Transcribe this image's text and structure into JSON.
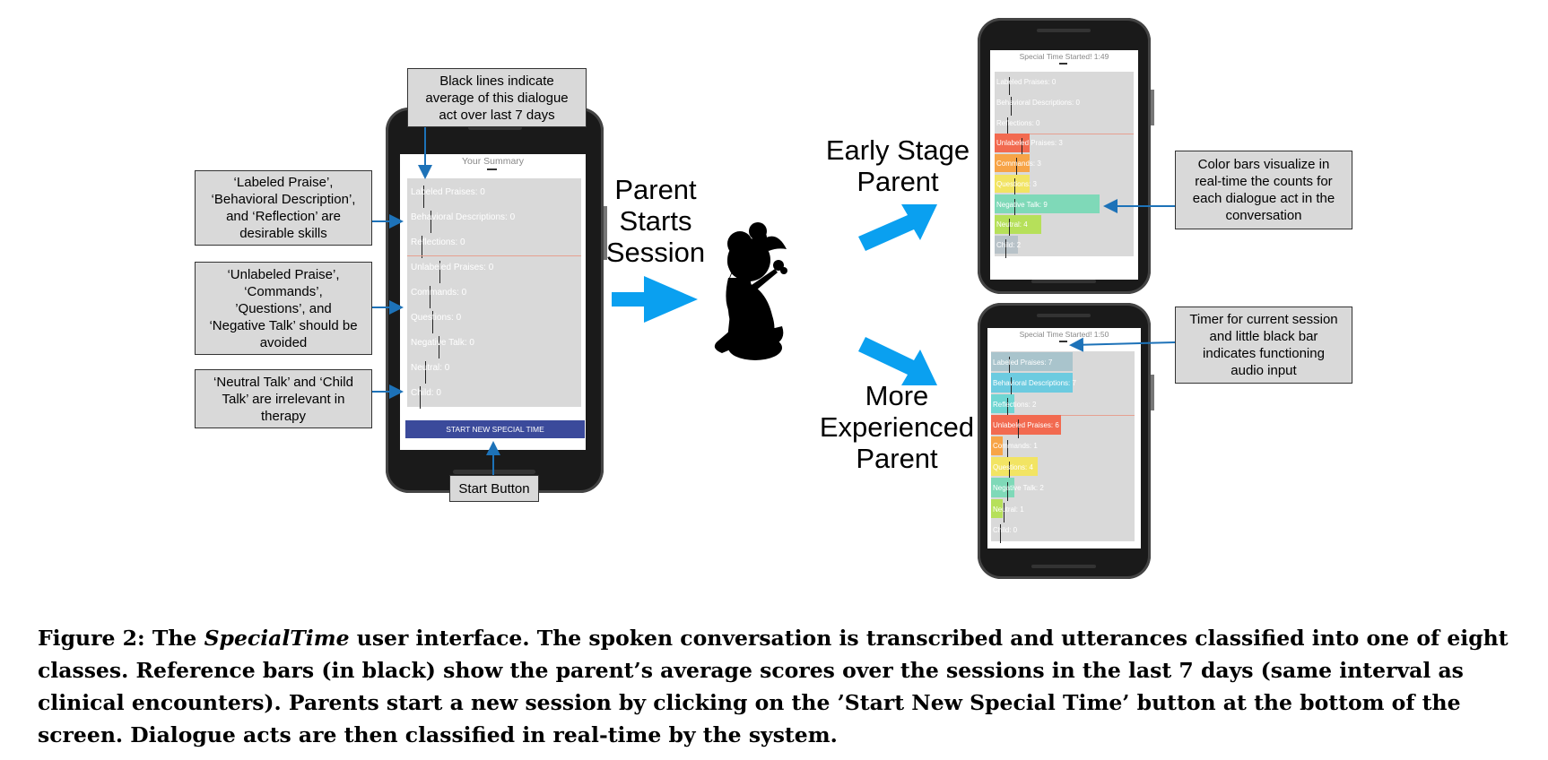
{
  "left_phone": {
    "title": "Your Summary",
    "rows": [
      {
        "label": "Labeled Praises: 0"
      },
      {
        "label": "Behavioral Descriptions: 0"
      },
      {
        "label": "Reflections: 0"
      },
      {
        "label": "Unlabeled Praises: 0"
      },
      {
        "label": "Commands: 0"
      },
      {
        "label": "Questions: 0"
      },
      {
        "label": "Negative Talk: 0"
      },
      {
        "label": "Neutral: 0"
      },
      {
        "label": "Child: 0"
      }
    ],
    "button_label": "START NEW SPECIAL TIME"
  },
  "top_phone": {
    "title": "Special Time Started! 1:49",
    "rows": [
      {
        "label": "Labeled Praises: 0",
        "count": 0,
        "color": ""
      },
      {
        "label": "Behavioral Descriptions: 0",
        "count": 0,
        "color": ""
      },
      {
        "label": "Reflections: 0",
        "count": 0,
        "color": ""
      },
      {
        "label": "Unlabeled Praises: 3",
        "count": 3,
        "color": "#f26a50"
      },
      {
        "label": "Commands: 3",
        "count": 3,
        "color": "#f7a447"
      },
      {
        "label": "Questions: 3",
        "count": 3,
        "color": "#f2e463"
      },
      {
        "label": "Negative Talk: 9",
        "count": 9,
        "color": "#7fd9b8"
      },
      {
        "label": "Neutral: 4",
        "count": 4,
        "color": "#b6e05a"
      },
      {
        "label": "Child: 2",
        "count": 2,
        "color": "#b8c2c8"
      }
    ]
  },
  "bottom_phone": {
    "title": "Special Time Started! 1:50",
    "rows": [
      {
        "label": "Labeled Praises: 7",
        "count": 7,
        "color": "#a9c4cc"
      },
      {
        "label": "Behavioral Descriptions: 7",
        "count": 7,
        "color": "#6ccbe0"
      },
      {
        "label": "Reflections: 2",
        "count": 2,
        "color": "#6fd6d2"
      },
      {
        "label": "Unlabeled Praises: 6",
        "count": 6,
        "color": "#f26a50"
      },
      {
        "label": "Commands: 1",
        "count": 1,
        "color": "#f7a447"
      },
      {
        "label": "Questions: 4",
        "count": 4,
        "color": "#f2e463"
      },
      {
        "label": "Negative Talk: 2",
        "count": 2,
        "color": "#7fd9b8"
      },
      {
        "label": "Neutral: 1",
        "count": 1,
        "color": "#b6e05a"
      },
      {
        "label": "Child: 0",
        "count": 0,
        "color": ""
      }
    ]
  },
  "callouts": {
    "black_lines": "Black lines indicate\naverage of this dialogue\nact over last 7 days",
    "desirable": "‘Labeled Praise’,\n‘Behavioral Description’,\nand ‘Reflection’ are\ndesirable skills",
    "avoided": "‘Unlabeled Praise’,\n‘Commands’,\n’Questions’, and\n‘Negative Talk’ should be\navoided",
    "irrelevant": "‘Neutral Talk’ and ‘Child\nTalk’ are irrelevant in\ntherapy",
    "start_button": "Start Button",
    "color_bars": "Color bars visualize in\nreal-time the counts for\neach dialogue act in the\nconversation",
    "timer": "Timer for current session\nand little black bar\nindicates functioning\naudio input"
  },
  "labels": {
    "parent_starts": "Parent\nStarts\nSession",
    "early_stage": "Early Stage\nParent",
    "more_experienced": "More\nExperienced\nParent"
  },
  "caption": {
    "prefix": "Figure 2: The ",
    "italic": "SpecialTime",
    "rest": " user interface. The spoken conversation is transcribed and utterances classified into one of eight classes. Reference bars (in black) show the parent’s average scores over the sessions in the last 7 days (same interval as clinical encounters). Parents start a new session by clicking on the ’Start New Special Time’ button at the bottom of the screen. Dialogue acts are then classified in real-time by the system."
  },
  "colors": {
    "arrow_blue": "#0aa0f0",
    "connector_blue": "#1d72b8",
    "button_navy": "#3b4a9b",
    "panel_gray": "#d9d9d9"
  }
}
